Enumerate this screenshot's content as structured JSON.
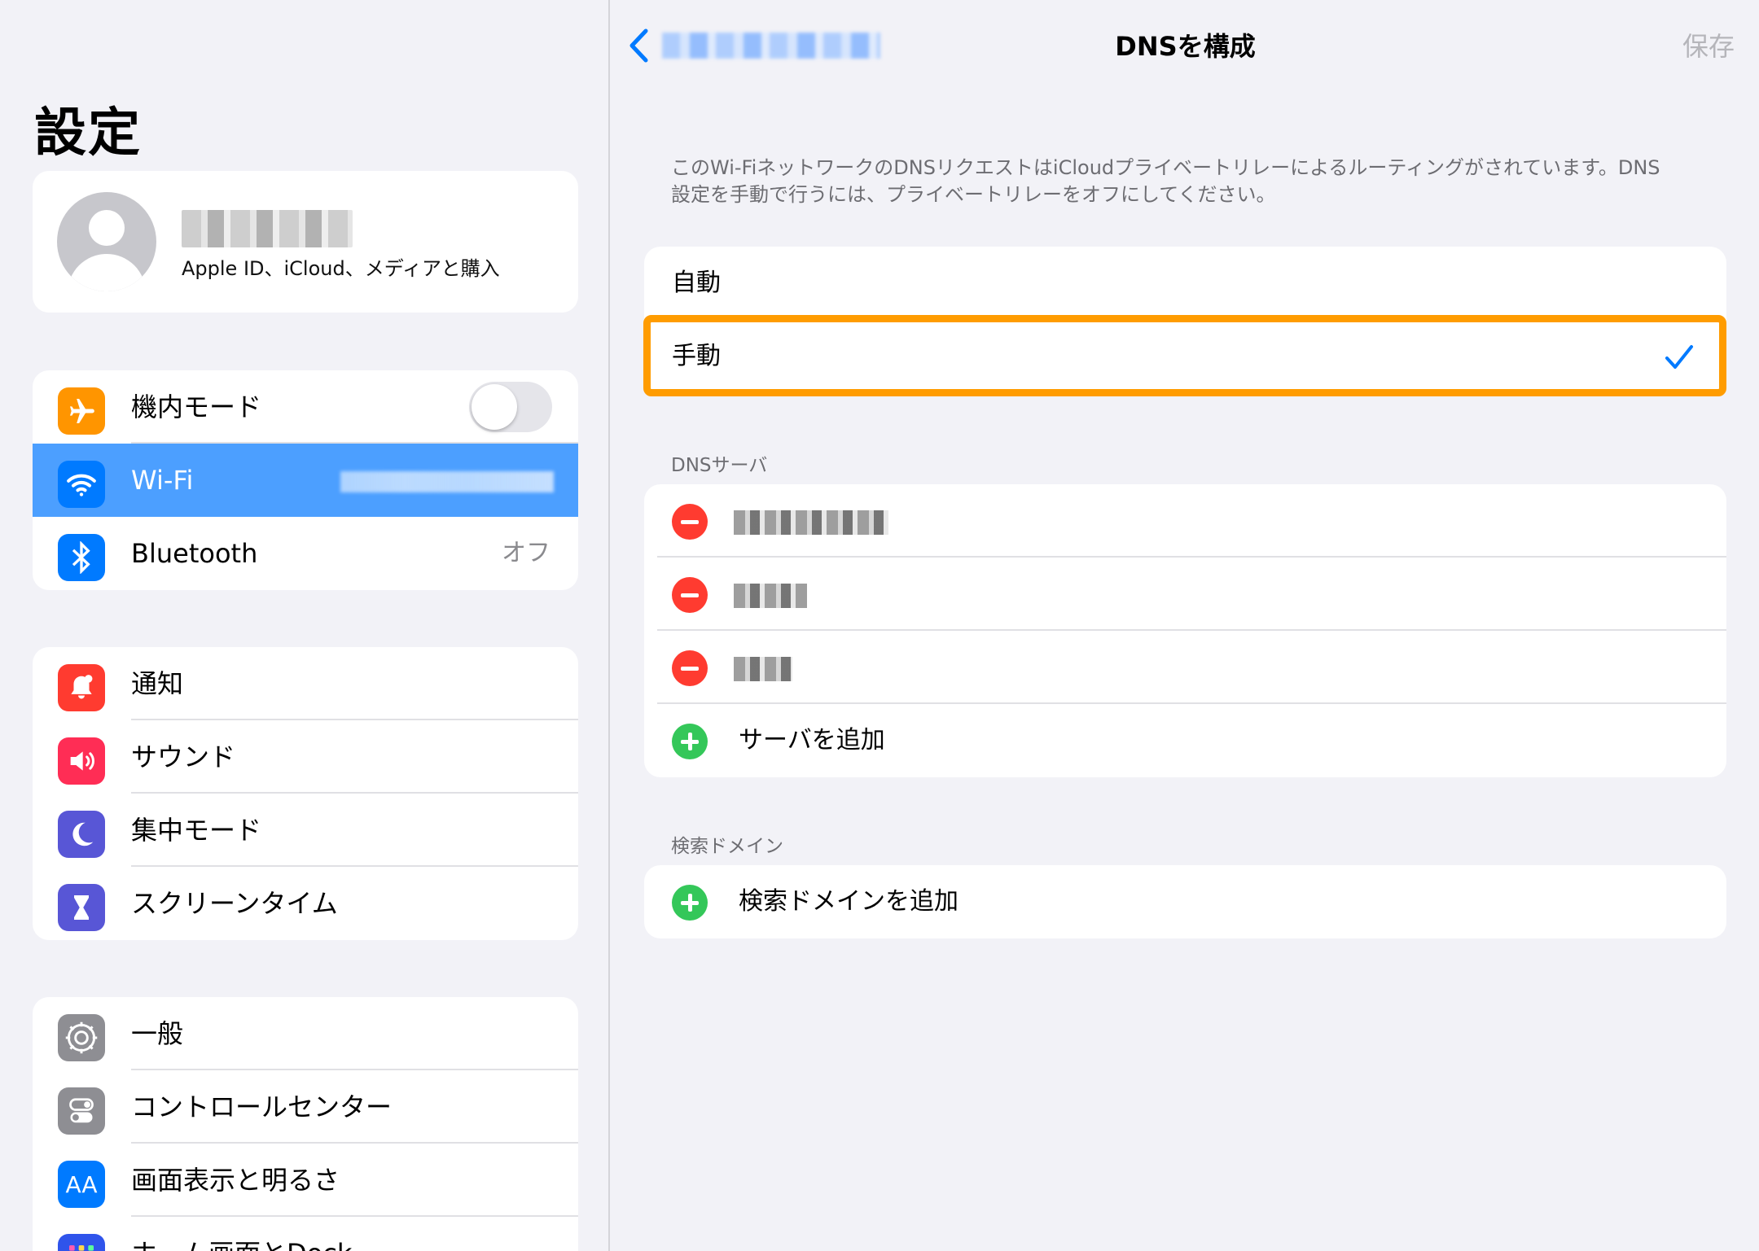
{
  "sidebar": {
    "title": "設定",
    "profile": {
      "subtitle": "Apple ID、iCloud、メディアと購入"
    },
    "network": [
      {
        "label": "機内モード",
        "icon": "airplane-icon",
        "color": "#ff9500"
      },
      {
        "label": "Wi-Fi",
        "icon": "wifi-icon",
        "color": "#007aff"
      },
      {
        "label": "Bluetooth",
        "icon": "bluetooth-icon",
        "color": "#007aff",
        "value": "オフ"
      }
    ],
    "notifications": [
      {
        "label": "通知",
        "icon": "bell-icon",
        "color": "#ff3b30"
      },
      {
        "label": "サウンド",
        "icon": "speaker-icon",
        "color": "#ff2d55"
      },
      {
        "label": "集中モード",
        "icon": "moon-icon",
        "color": "#5856d6"
      },
      {
        "label": "スクリーンタイム",
        "icon": "hourglass-icon",
        "color": "#5856d6"
      }
    ],
    "general": [
      {
        "label": "一般",
        "icon": "gear-icon",
        "color": "#8e8e93"
      },
      {
        "label": "コントロールセンター",
        "icon": "switches-icon",
        "color": "#8e8e93"
      },
      {
        "label": "画面表示と明るさ",
        "icon": "text-size-icon",
        "color": "#007aff",
        "glyph": "AA"
      },
      {
        "label": "ホーム画面とDock",
        "icon": "home-grid-icon",
        "color": "#2f54eb"
      }
    ]
  },
  "detail": {
    "nav_title": "DNSを構成",
    "save_label": "保存",
    "notice": "このWi-FiネットワークのDNSリクエストはiCloudプライベートリレーによるルーティングがされています。DNS設定を手動で行うには、プライベートリレーをオフにしてください。",
    "modes": [
      {
        "label": "自動",
        "selected": false
      },
      {
        "label": "手動",
        "selected": true
      }
    ],
    "dns_header": "DNSサーバ",
    "add_server_label": "サーバを追加",
    "domain_header": "検索ドメイン",
    "add_domain_label": "検索ドメインを追加",
    "highlight_color": "#ff9c00"
  }
}
